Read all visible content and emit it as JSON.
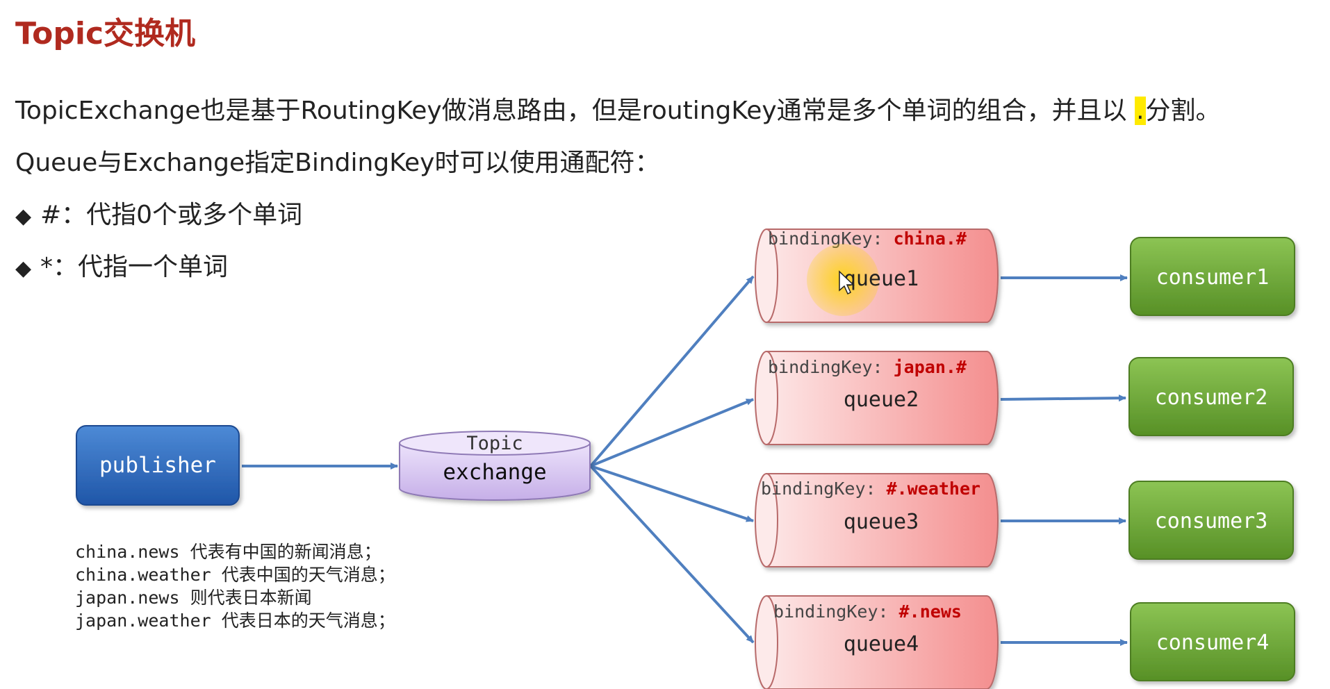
{
  "title": "Topic交换机",
  "intro": {
    "line1_before": "TopicExchange也是基于RoutingKey做消息路由，但是routingKey通常是多个单词的组合，并且以 ",
    "line1_highlight": ".",
    "line1_after": "分割。",
    "line2": "Queue与Exchange指定BindingKey时可以使用通配符："
  },
  "bullets": [
    {
      "mark": "◆",
      "text": "#：代指0个或多个单词"
    },
    {
      "mark": "◆",
      "text": "*：代指一个单词"
    }
  ],
  "diagram": {
    "publisher": "publisher",
    "exchange": {
      "type_label": "Topic",
      "name": "exchange"
    },
    "binding_prefix": "bindingKey: ",
    "queues": [
      {
        "name": "queue1",
        "binding": "china.#",
        "consumer": "consumer1"
      },
      {
        "name": "queue2",
        "binding": "japan.#",
        "consumer": "consumer2"
      },
      {
        "name": "queue3",
        "binding": "#.weather",
        "consumer": "consumer3"
      },
      {
        "name": "queue4",
        "binding": "#.news",
        "consumer": "consumer4"
      }
    ],
    "colors": {
      "publisher": "#2f6bbd",
      "exchange": "#d9c8f2",
      "queue": "#f8b0b0",
      "consumer": "#6aa535",
      "arrow": "#4f7fbf",
      "binding_value": "#c00000",
      "cursor_highlight": "#ffd400"
    }
  },
  "examples": [
    {
      "key": "china.news",
      "desc": "代表有中国的新闻消息；"
    },
    {
      "key": "china.weather",
      "desc": "代表中国的天气消息；"
    },
    {
      "key": "japan.news",
      "desc": "则代表日本新闻"
    },
    {
      "key": "japan.weather",
      "desc": "代表日本的天气消息；"
    }
  ]
}
